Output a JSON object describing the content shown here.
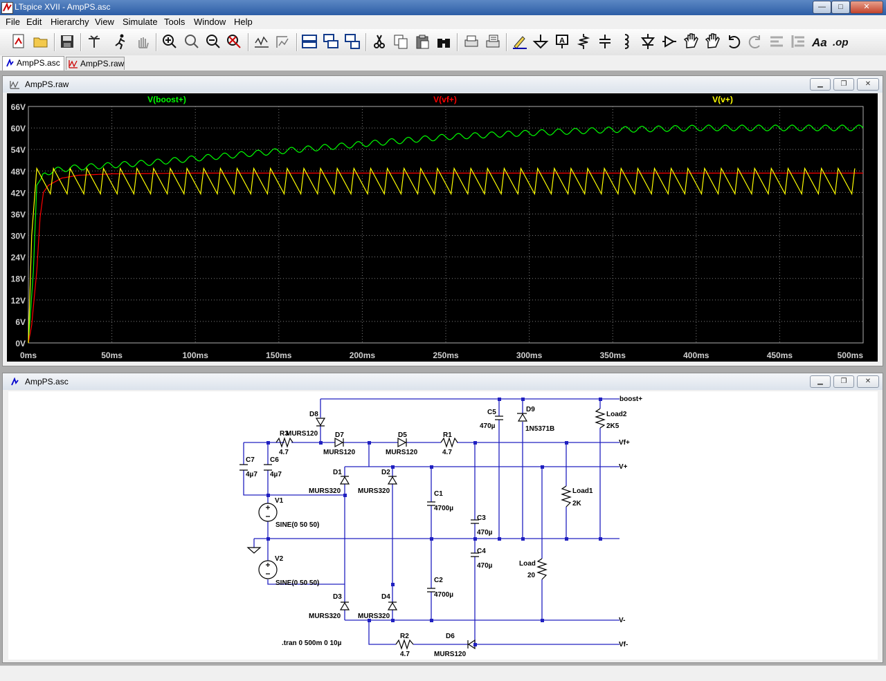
{
  "window": {
    "title": "LTspice XVII - AmpPS.asc",
    "minimize": "—",
    "maximize": "□",
    "close": "✕"
  },
  "menu": [
    "File",
    "Edit",
    "Hierarchy",
    "View",
    "Simulate",
    "Tools",
    "Window",
    "Help"
  ],
  "toolbar_icons": [
    "new-schematic-icon",
    "open-icon",
    "save-icon",
    "control-panel-icon",
    "run-icon",
    "halt-icon",
    "zoom-in-icon",
    "zoom-pan-icon",
    "zoom-out-icon",
    "zoom-fit-icon",
    "autorange-icon",
    "pick-visible-icon",
    "tile-horizontal-icon",
    "cascade-icon",
    "tile-vertical-icon",
    "cut-icon",
    "copy-icon",
    "paste-icon",
    "find-icon",
    "print-icon",
    "print-setup-icon",
    "draw-wire-icon",
    "ground-icon",
    "label-net-icon",
    "resistor-icon",
    "capacitor-icon",
    "inductor-icon",
    "diode-icon",
    "component-icon",
    "move-icon",
    "drag-icon",
    "undo-icon",
    "redo-icon",
    "rotate-icon",
    "mirror-icon",
    "text-icon",
    "spice-directive-icon"
  ],
  "tabs": [
    {
      "label": "AmpPS.asc",
      "active": true
    },
    {
      "label": "AmpPS.raw",
      "active": false
    }
  ],
  "waveform_window": {
    "title": "AmpPS.raw"
  },
  "schematic_window": {
    "title": "AmpPS.asc"
  },
  "chart_data": {
    "type": "line",
    "title": "",
    "xlabel": "",
    "ylabel": "",
    "xlim": [
      0,
      500
    ],
    "ylim": [
      0,
      66
    ],
    "x_ticks": [
      "0ms",
      "50ms",
      "100ms",
      "150ms",
      "200ms",
      "250ms",
      "300ms",
      "350ms",
      "400ms",
      "450ms",
      "500ms"
    ],
    "y_ticks": [
      "0V",
      "6V",
      "12V",
      "18V",
      "24V",
      "30V",
      "36V",
      "42V",
      "48V",
      "54V",
      "60V",
      "66V"
    ],
    "grid": true,
    "legend_position": "top",
    "background": "#000000",
    "series": [
      {
        "name": "V(boost+)",
        "color": "#00ff00",
        "kind": "boost",
        "points": [
          [
            0,
            0
          ],
          [
            3,
            20
          ],
          [
            5,
            44
          ],
          [
            10,
            47.5
          ],
          [
            20,
            48.5
          ],
          [
            30,
            49
          ],
          [
            40,
            49.3
          ],
          [
            50,
            49.6
          ],
          [
            75,
            50.4
          ],
          [
            100,
            51.5
          ],
          [
            150,
            53.5
          ],
          [
            200,
            55.5
          ],
          [
            250,
            57.5
          ],
          [
            300,
            58.6
          ],
          [
            350,
            59.5
          ],
          [
            400,
            60
          ],
          [
            450,
            60
          ],
          [
            500,
            60
          ]
        ],
        "ripple": 0.8
      },
      {
        "name": "V(vf+)",
        "color": "#ff0000",
        "kind": "smooth",
        "points": [
          [
            0,
            0
          ],
          [
            2,
            5
          ],
          [
            5,
            20
          ],
          [
            7,
            35
          ],
          [
            9,
            42
          ],
          [
            12,
            44
          ],
          [
            20,
            46
          ],
          [
            30,
            46.8
          ],
          [
            50,
            47.2
          ],
          [
            100,
            47.4
          ],
          [
            500,
            47.4
          ]
        ]
      },
      {
        "name": "V(v+)",
        "color": "#ffff00",
        "kind": "sawtooth",
        "peak": 48.7,
        "trough": 41.6,
        "period": 10,
        "first_peak": 5
      }
    ]
  },
  "schematic": {
    "labels": {
      "boost": "boost+",
      "vfp": "Vf+",
      "vp": "V+",
      "vm": "V-",
      "vfm": "Vf-",
      "D8": "D8",
      "D8m": "MURS120",
      "R3": "R3",
      "R3v": "4.7",
      "D7": "D7",
      "D7m": "MURS120",
      "D5": "D5",
      "D5m": "MURS120",
      "R1": "R1",
      "R1v": "4.7",
      "C5": "C5",
      "C5v": "470µ",
      "D9": "D9",
      "D9m": "1N5371B",
      "Load2": "Load2",
      "Load2v": "2K5",
      "C7": "C7",
      "C7v": "4µ7",
      "C6": "C6",
      "C6v": "4µ7",
      "D1": "D1",
      "D1m": "MURS320",
      "D2": "D2",
      "D2m": "MURS320",
      "C1": "C1",
      "C1v": "4700µ",
      "C3": "C3",
      "C3v": "470µ",
      "C4": "C4",
      "C4v": "470µ",
      "Load1": "Load1",
      "Load1v": "2K",
      "Load": "Load",
      "Loadv": "20",
      "V1": "V1",
      "V1v": "SINE(0 50 50)",
      "V2": "V2",
      "V2v": "SINE(0 50 50)",
      "C2": "C2",
      "C2v": "4700µ",
      "D3": "D3",
      "D3m": "MURS320",
      "D4": "D4",
      "D4m": "MURS320",
      "R2": "R2",
      "R2v": "4.7",
      "D6": "D6",
      "D6m": "MURS120",
      "tran": ".tran 0 500m 0 10µ"
    }
  }
}
